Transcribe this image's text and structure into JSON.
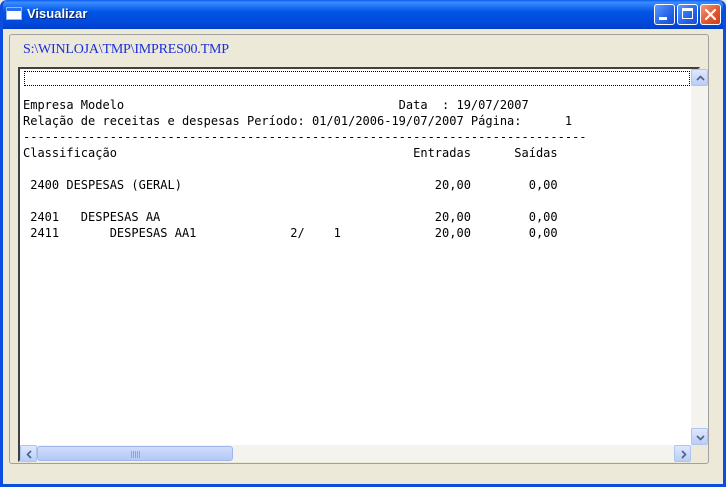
{
  "window": {
    "title": "Visualizar"
  },
  "file_path": "S:\\WINLOJA\\TMP\\IMPRES00.TMP",
  "report": {
    "lines": [
      "Empresa Modelo                                      Data  : 19/07/2007",
      "Relação de receitas e despesas Período: 01/01/2006-19/07/2007 Página:      1",
      "------------------------------------------------------------------------------",
      "Classificação                                         Entradas      Saídas",
      "",
      " 2400 DESPESAS (GERAL)                                   20,00        0,00",
      "",
      " 2401   DESPESAS AA                                      20,00        0,00",
      " 2411       DESPESAS AA1             2/    1             20,00        0,00"
    ]
  },
  "icons": {
    "window_icon": "window-icon",
    "minimize": "minimize-icon",
    "maximize": "maximize-icon",
    "close": "close-icon",
    "scroll_up": "arrow-up-icon",
    "scroll_down": "arrow-down-icon",
    "scroll_left": "arrow-left-icon",
    "scroll_right": "arrow-right-icon"
  },
  "colors": {
    "titlebar": "#0055e5",
    "close_button": "#e2572f",
    "path_text": "#1c2fd8"
  }
}
